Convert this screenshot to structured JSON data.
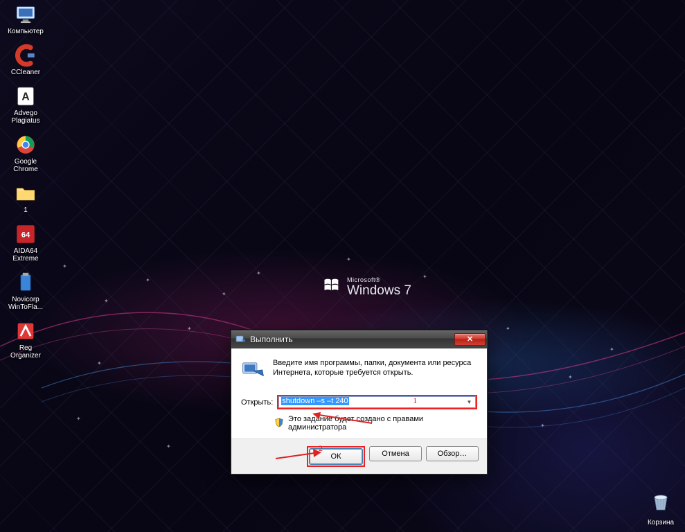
{
  "brand": {
    "small": "Microsoft®",
    "big": "Windows 7"
  },
  "desktop_icons": [
    {
      "key": "computer",
      "label": "Компьютер"
    },
    {
      "key": "ccleaner",
      "label": "CCleaner"
    },
    {
      "key": "advego",
      "label": "Advego Plagiatus"
    },
    {
      "key": "chrome",
      "label": "Google Chrome"
    },
    {
      "key": "folder1",
      "label": "1"
    },
    {
      "key": "aida64",
      "label": "AIDA64 Extreme"
    },
    {
      "key": "wintoflash",
      "label": "Novicorp WinToFla..."
    },
    {
      "key": "regorg",
      "label": "Reg Organizer"
    }
  ],
  "recycle_bin": {
    "label": "Корзина"
  },
  "dialog": {
    "title": "Выполнить",
    "description": "Введите имя программы, папки, документа или ресурса Интернета, которые требуется открыть.",
    "open_label": "Открыть:",
    "input_value": "shutdown –s –t 240",
    "admin_note": "Это задание будет создано с правами администратора",
    "buttons": {
      "ok": "ОК",
      "cancel": "Отмена",
      "browse": "Обзор…"
    }
  },
  "annotations": {
    "one": "1",
    "two": "2"
  }
}
